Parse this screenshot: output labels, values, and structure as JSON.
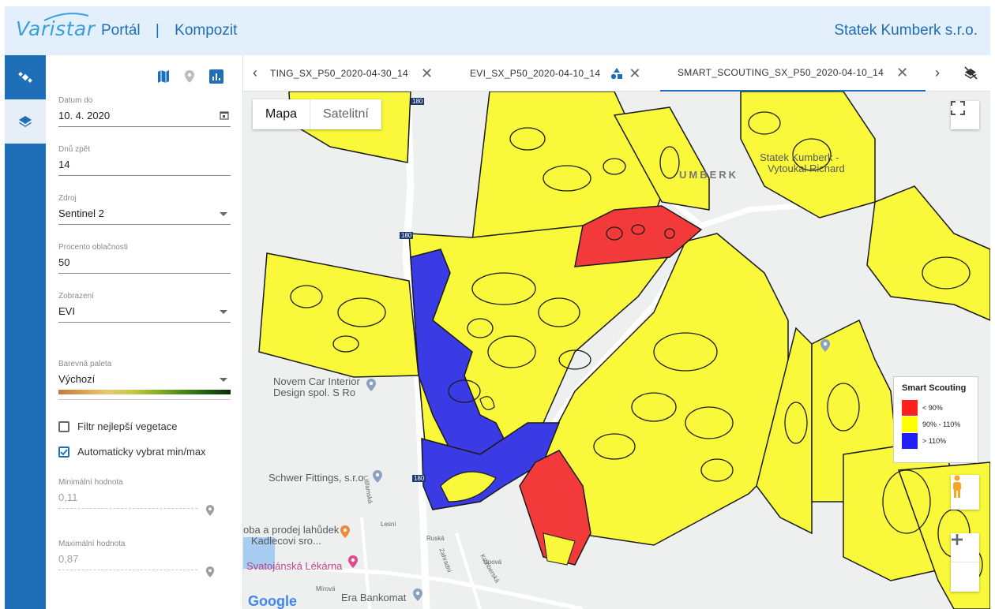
{
  "header": {
    "logo": "Varistar",
    "nav": [
      "Portál",
      "|",
      "Kompozit"
    ],
    "company": "Statek Kumberk s.r.o."
  },
  "rail": {
    "items": [
      "satellite-icon",
      "layers-icon"
    ],
    "active": "layers-icon"
  },
  "sidebar": {
    "tools": [
      "map-icon",
      "location-icon",
      "chart-icon"
    ],
    "date_to": {
      "label": "Datum do",
      "value": "10. 4. 2020"
    },
    "days_back": {
      "label": "Dnů zpět",
      "value": "14"
    },
    "source": {
      "label": "Zdroj",
      "value": "Sentinel 2"
    },
    "cloud": {
      "label": "Procento oblačnosti",
      "value": "50"
    },
    "display": {
      "label": "Zobrazení",
      "value": "EVI"
    },
    "palette": {
      "label": "Barevná paleta",
      "value": "Výchozí"
    },
    "best_veg_filter": {
      "label": "Filtr nejlepší vegetace",
      "checked": false
    },
    "auto_minmax": {
      "label": "Automaticky vybrat min/max",
      "checked": true
    },
    "min_value": {
      "label": "Minimální hodnota",
      "value": "0,11"
    },
    "max_value": {
      "label": "Maximální hodnota",
      "value": "0,87"
    }
  },
  "tabs": {
    "items": [
      {
        "label": "TING_SX_P50_2020-04-30_14"
      },
      {
        "label": "EVI_SX_P50_2020-04-10_14"
      },
      {
        "label": "SMART_SCOUTING_SX_P50_2020-04-10_14"
      }
    ],
    "active_index": 2
  },
  "map": {
    "type_options": [
      "Mapa",
      "Satelitní"
    ],
    "selected_type": "Mapa",
    "labels": {
      "farm": "Statek Kumberk -",
      "farm2": "Vytoukal Richard",
      "kumberk": "UMBERK",
      "novem": "Novem Car Interior",
      "novem2": "Design spol. S Ro",
      "schwer": "Schwer Fittings, s.r.o",
      "lahudek": "oba a prodej lahůdek",
      "kadlec": "Kadlecovi sro...",
      "lekarna": "Svatojánská Lékárna",
      "bankomat": "Era Bankomat",
      "lisfamska": "Lišfamská",
      "lesni": "Lesní",
      "ruska": "Ruská",
      "zahradni": "Zahradní",
      "kumberska": "Kumberská",
      "upova": "Úpová",
      "mirova": "Mírová",
      "roadnum1": "180",
      "roadnum2": "180",
      "roadnum3": "180",
      "google": "Google"
    },
    "legend": {
      "title": "Smart Scouting",
      "items": [
        {
          "label": "< 90%",
          "color": "#ff2020"
        },
        {
          "label": "90% - 110%",
          "color": "#ffff00"
        },
        {
          "label": "> 110%",
          "color": "#1f1fff"
        }
      ]
    },
    "colors": {
      "yellow": "#f9f83a",
      "red": "#f23a3a",
      "blue": "#3b3be6"
    }
  }
}
